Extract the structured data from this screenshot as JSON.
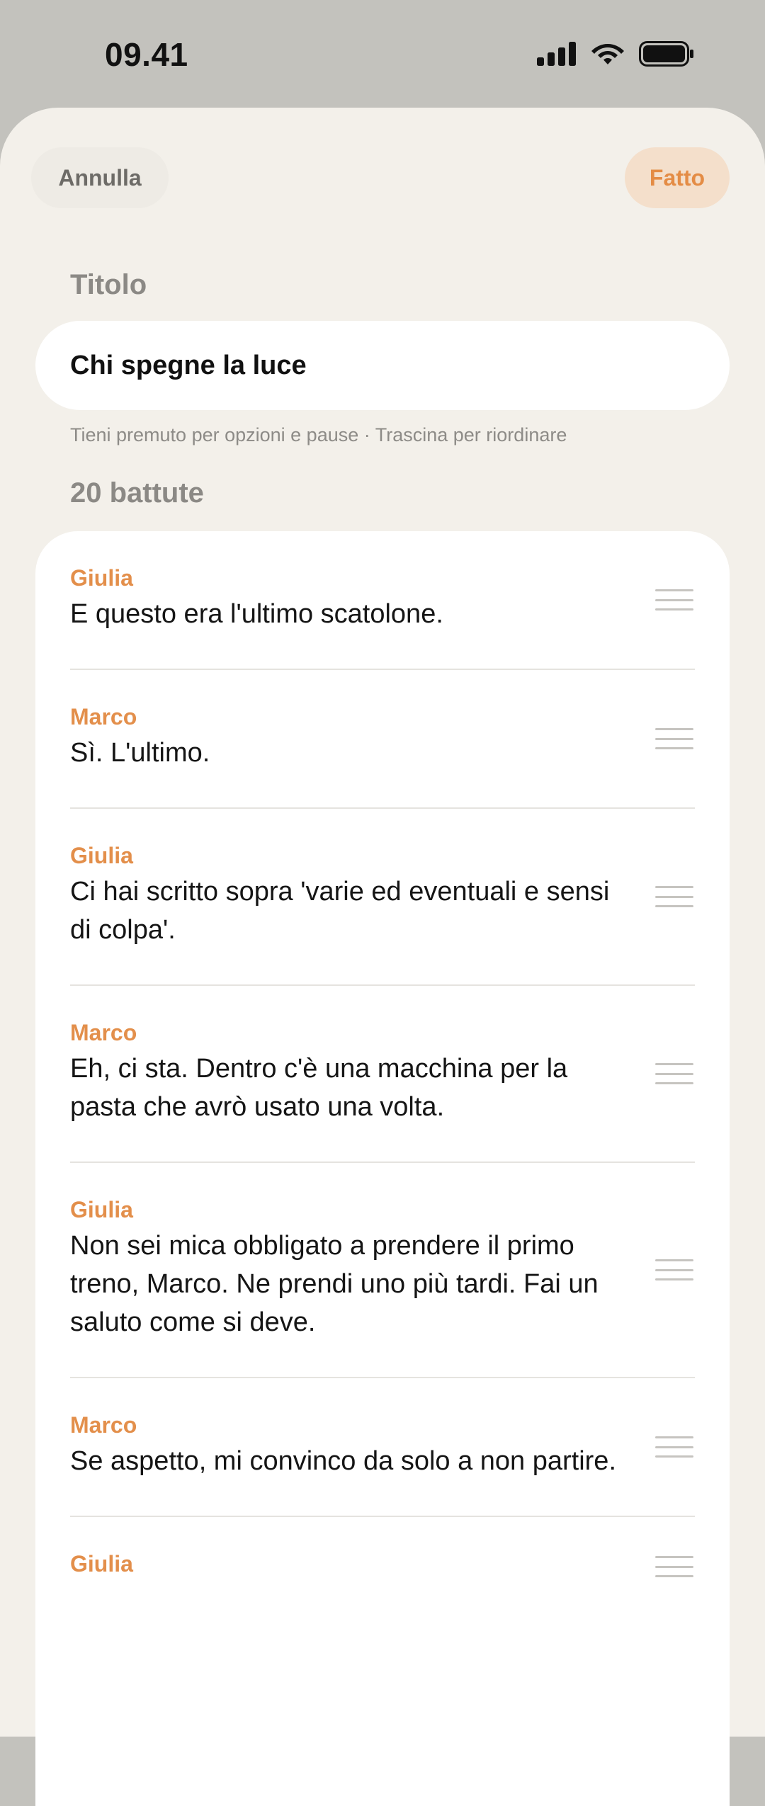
{
  "status_bar": {
    "time": "09.41",
    "icons": [
      "signal-icon",
      "wifi-icon",
      "battery-icon"
    ]
  },
  "header": {
    "cancel_label": "Annulla",
    "done_label": "Fatto"
  },
  "form": {
    "title_label": "Titolo",
    "title_value": "Chi spegne la luce",
    "hint": "Tieni premuto per opzioni e pause · Trascina per riordinare",
    "count_label": "20 battute"
  },
  "lines": [
    {
      "speaker": "Giulia",
      "text": "E questo era l'ultimo scatolone."
    },
    {
      "speaker": "Marco",
      "text": "Sì. L'ultimo."
    },
    {
      "speaker": "Giulia",
      "text": "Ci hai scritto sopra 'varie ed eventuali e sensi di colpa'."
    },
    {
      "speaker": "Marco",
      "text": "Eh, ci sta. Dentro c'è una macchina per la pasta che avrò usato una volta."
    },
    {
      "speaker": "Giulia",
      "text": "Non sei mica obbligato a prendere il primo treno, Marco. Ne prendi uno più tardi. Fai un saluto come si deve."
    },
    {
      "speaker": "Marco",
      "text": "Se aspetto, mi convinco da solo a non partire."
    },
    {
      "speaker": "Giulia",
      "text": ""
    }
  ],
  "colors": {
    "accent": "#e48c45",
    "accent_soft": "#f4dfcb",
    "sheet_bg": "#f3f0ea",
    "backdrop": "#c3c2bd"
  }
}
